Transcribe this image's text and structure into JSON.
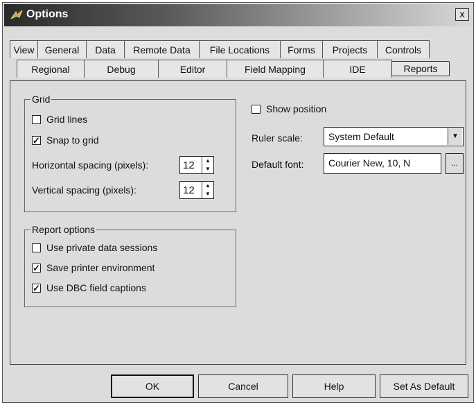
{
  "window": {
    "title": "Options",
    "close_label": "x"
  },
  "tabs_row1": [
    "View",
    "General",
    "Data",
    "Remote Data",
    "File Locations",
    "Forms",
    "Projects",
    "Controls"
  ],
  "tabs_row2": [
    "Regional",
    "Debug",
    "Editor",
    "Field Mapping",
    "IDE",
    "Reports"
  ],
  "active_tab": "Reports",
  "grid": {
    "label": "Grid",
    "grid_lines": {
      "label": "Grid lines",
      "checked": false
    },
    "snap_to_grid": {
      "label": "Snap to grid",
      "checked": true
    },
    "horizontal_spacing": {
      "label": "Horizontal spacing (pixels):",
      "value": "12"
    },
    "vertical_spacing": {
      "label": "Vertical spacing (pixels):",
      "value": "12"
    }
  },
  "report_options": {
    "label": "Report options",
    "private_sessions": {
      "label": "Use private data sessions",
      "checked": false
    },
    "printer_env": {
      "label": "Save printer environment",
      "checked": true
    },
    "dbc_captions": {
      "label": "Use DBC field captions",
      "checked": true
    }
  },
  "right": {
    "show_position": {
      "label": "Show position",
      "checked": false
    },
    "ruler_scale": {
      "label": "Ruler scale:",
      "value": "System Default"
    },
    "default_font": {
      "label": "Default font:",
      "value": "Courier New, 10, N",
      "button": "..."
    }
  },
  "buttons": {
    "ok": "OK",
    "cancel": "Cancel",
    "help": "Help",
    "set_default": "Set As Default"
  }
}
